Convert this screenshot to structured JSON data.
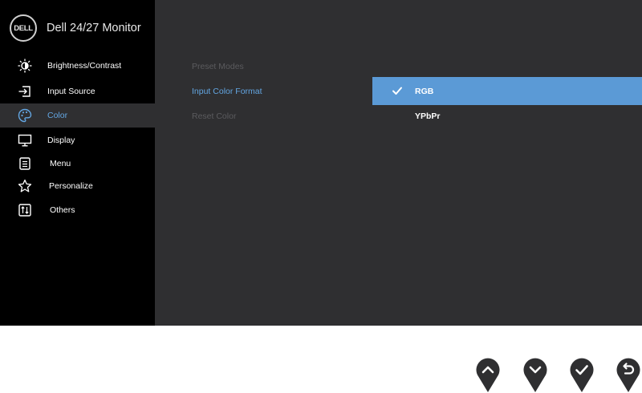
{
  "osd": {
    "brand": "DELL",
    "title": "Dell 24/27 Monitor",
    "menu": [
      {
        "label": "Brightness/Contrast",
        "icon": "brightness-icon"
      },
      {
        "label": "Input Source",
        "icon": "input-source-icon"
      },
      {
        "label": "Color",
        "icon": "color-palette-icon",
        "active": true
      },
      {
        "label": "Display",
        "icon": "display-icon"
      },
      {
        "label": "Menu",
        "icon": "menu-icon"
      },
      {
        "label": "Personalize",
        "icon": "star-icon"
      },
      {
        "label": "Others",
        "icon": "others-icon"
      }
    ],
    "submenu": [
      {
        "label": "Preset Modes",
        "state": "disabled"
      },
      {
        "label": "Input Color Format",
        "state": "selected"
      },
      {
        "label": "Reset Color",
        "state": "disabled"
      }
    ],
    "choices": [
      {
        "label": "RGB",
        "checked": true
      },
      {
        "label": "YPbPr",
        "checked": false
      }
    ]
  },
  "buttons": [
    {
      "icon": "up-icon"
    },
    {
      "icon": "down-icon"
    },
    {
      "icon": "check-icon"
    },
    {
      "icon": "back-icon"
    }
  ],
  "colors": {
    "accent": "#63a6e2",
    "highlight": "#5b9ad6",
    "panel": "#2f2f31",
    "sidebar": "#000000"
  }
}
